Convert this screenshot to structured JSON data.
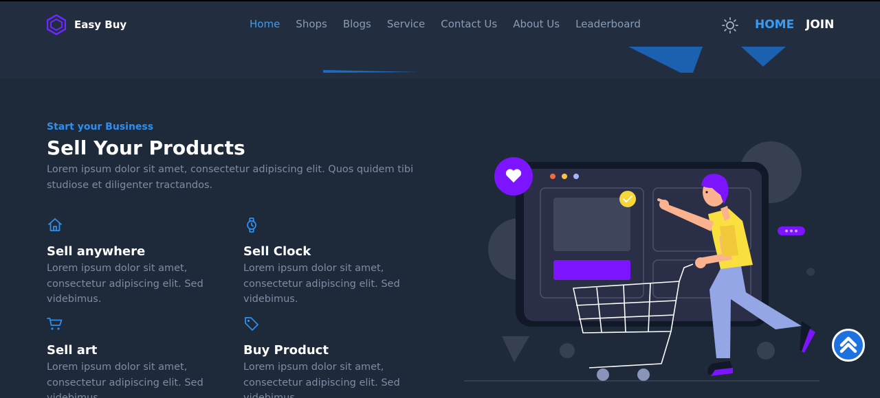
{
  "brand": {
    "name": "Easy Buy",
    "logo_icon": "hexagon-logo-icon",
    "color": "#6d28ff"
  },
  "nav": {
    "items": [
      {
        "label": "Home",
        "active": true
      },
      {
        "label": "Shops",
        "active": false
      },
      {
        "label": "Blogs",
        "active": false
      },
      {
        "label": "Service",
        "active": false
      },
      {
        "label": "Contact Us",
        "active": false
      },
      {
        "label": "About Us",
        "active": false
      },
      {
        "label": "Leaderboard",
        "active": false
      }
    ]
  },
  "header_actions": {
    "theme_icon": "sun-icon",
    "home_label": "HOME",
    "join_label": "JOIN"
  },
  "hero": {
    "eyebrow": "Start your Business",
    "title": "Sell Your Products",
    "description": "Lorem ipsum dolor sit amet, consectetur adipiscing elit. Quos quidem tibi studiose et diligenter tractandos."
  },
  "features": [
    {
      "icon": "home-icon",
      "title": "Sell anywhere",
      "text": "Lorem ipsum dolor sit amet, consectetur adipiscing elit. Sed videbimus."
    },
    {
      "icon": "watch-icon",
      "title": "Sell Clock",
      "text": "Lorem ipsum dolor sit amet, consectetur adipiscing elit. Sed videbimus."
    },
    {
      "icon": "cart-icon",
      "title": "Sell art",
      "text": "Lorem ipsum dolor sit amet, consectetur adipiscing elit. Sed videbimus."
    },
    {
      "icon": "tag-icon",
      "title": "Buy Product",
      "text": "Lorem ipsum dolor sit amet, consectetur adipiscing elit. Sed videbimus."
    }
  ],
  "illustration": {
    "subject": "shopper-with-cart-illustration"
  },
  "scroll_top": {
    "icon": "chevron-up-icon"
  },
  "colors": {
    "accent": "#3b9cf5",
    "purple": "#7c14ff",
    "background": "#1e2939",
    "header": "#222e3f"
  }
}
